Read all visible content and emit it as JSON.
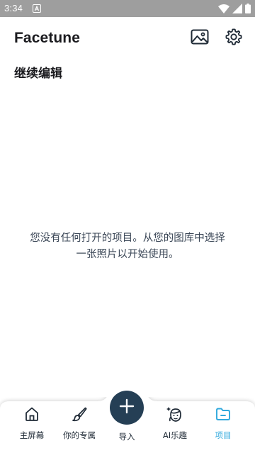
{
  "status_bar": {
    "time": "3:34",
    "notification_icon": "a-icon",
    "wifi_icon": "wifi-icon",
    "signal_icon": "signal-icon",
    "battery_icon": "battery-icon"
  },
  "header": {
    "app_title": "Facetune",
    "gallery_icon": "gallery-icon",
    "settings_icon": "gear-icon"
  },
  "section": {
    "title": "继续编辑"
  },
  "empty_state": {
    "message": "您没有任何打开的项目。从您的图库中选择一张照片以开始使用。"
  },
  "bottom_nav": {
    "items": [
      {
        "label": "主屏幕",
        "icon": "home-icon",
        "active": false
      },
      {
        "label": "你的专属",
        "icon": "brush-icon",
        "active": false
      },
      {
        "label": "导入",
        "icon": "plus-icon",
        "active": false
      },
      {
        "label": "AI乐趣",
        "icon": "ai-face-icon",
        "active": false
      },
      {
        "label": "项目",
        "icon": "folder-icon",
        "active": true
      }
    ],
    "active_color": "#2fa8dd",
    "import_button_color": "#253f55"
  },
  "colors": {
    "status_bar_bg": "#9e9e9e",
    "text_primary": "#1b1b1f",
    "text_secondary": "#3a4656"
  }
}
